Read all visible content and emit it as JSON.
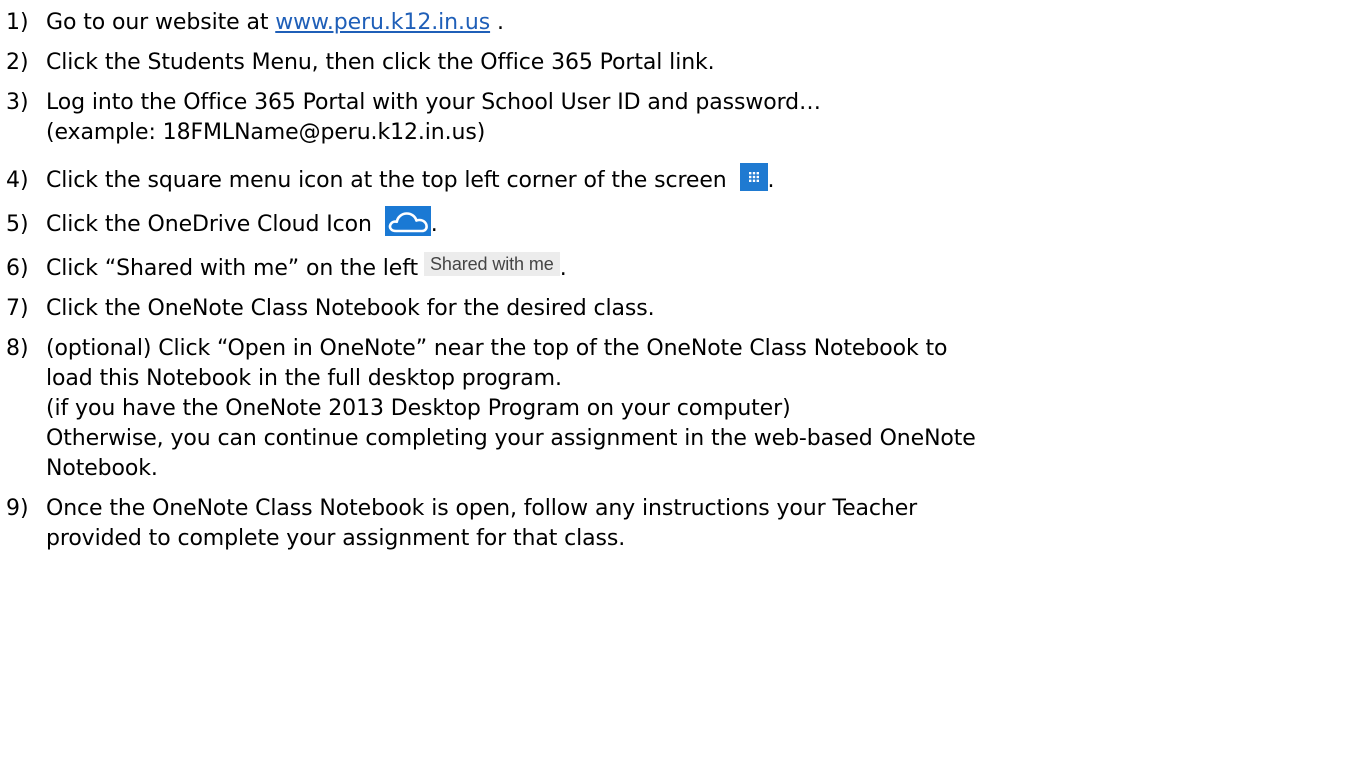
{
  "steps": [
    {
      "number": "1)",
      "text_before": "Go to our website at ",
      "link": "www.peru.k12.in.us",
      "text_after": " ."
    },
    {
      "number": "2)",
      "text": "Click the Students Menu, then click the Office 365 Portal link."
    },
    {
      "number": "3)",
      "line1": "Log into the Office 365 Portal with your School User ID and password…",
      "line2": "(example: 18FMLName@peru.k12.in.us)"
    },
    {
      "number": "4)",
      "text": "Click the square menu icon at the top left corner of the screen",
      "icon": "app-launcher-grid-icon",
      "suffix": "."
    },
    {
      "number": "5)",
      "text": "Click the OneDrive Cloud Icon",
      "icon": "onedrive-cloud-icon",
      "suffix": "."
    },
    {
      "number": "6)",
      "text": "Click “Shared with me” on the left",
      "chip": "Shared with me",
      "suffix": "."
    },
    {
      "number": "7)",
      "text": "Click the OneNote Class Notebook for the desired class."
    },
    {
      "number": "8)",
      "line1": "(optional) Click “Open in OneNote” near the top of the OneNote Class Notebook to",
      "line2": "load this Notebook in the full desktop program.",
      "line3": "(if you have the OneNote 2013 Desktop Program on your computer)",
      "line4": "Otherwise, you can continue completing your assignment in the web-based OneNote",
      "line5": "Notebook."
    },
    {
      "number": "9)",
      "line1": "Once the OneNote Class Notebook is open, follow any instructions your Teacher",
      "line2": "provided to complete your assignment for that class."
    }
  ],
  "colors": {
    "link": "#1f5fb8",
    "tile_blue": "#1f7ad1",
    "chip_bg": "#ececec"
  }
}
